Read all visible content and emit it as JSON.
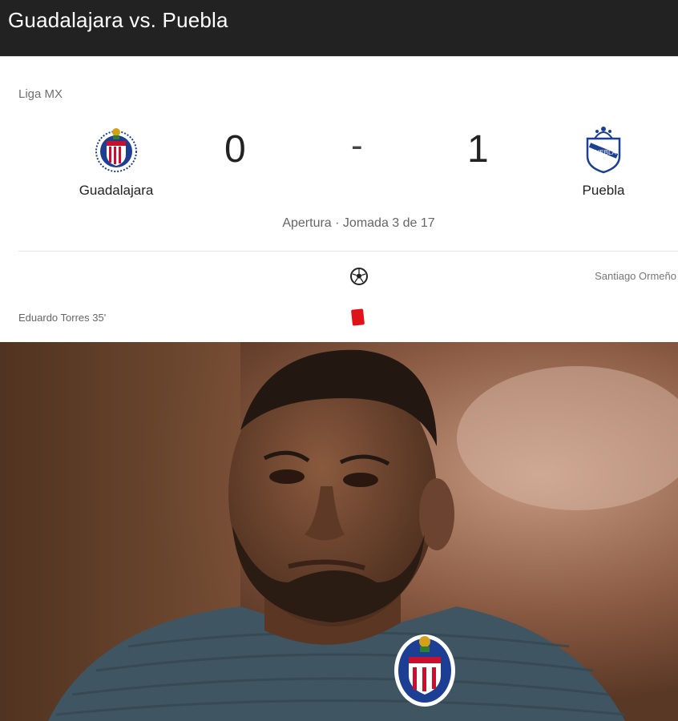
{
  "header": {
    "title": "Guadalajara vs. Puebla"
  },
  "match": {
    "league": "Liga MX",
    "home_team": "Guadalajara",
    "away_team": "Puebla",
    "home_score": "0",
    "score_separator": "-",
    "away_score": "1",
    "round_info": "Apertura · Jomada 3 de 17"
  },
  "events": {
    "goal_icon": "soccer-ball-icon",
    "goal_player_away": "Santiago Ormeño",
    "red_card_icon": "red-card-icon",
    "red_card_player_home": "Eduardo Torres 35'"
  },
  "colors": {
    "header_bg": "#222222",
    "red_card": "#e0121a",
    "chivas_red": "#c8102e",
    "chivas_blue": "#1c3f94"
  }
}
